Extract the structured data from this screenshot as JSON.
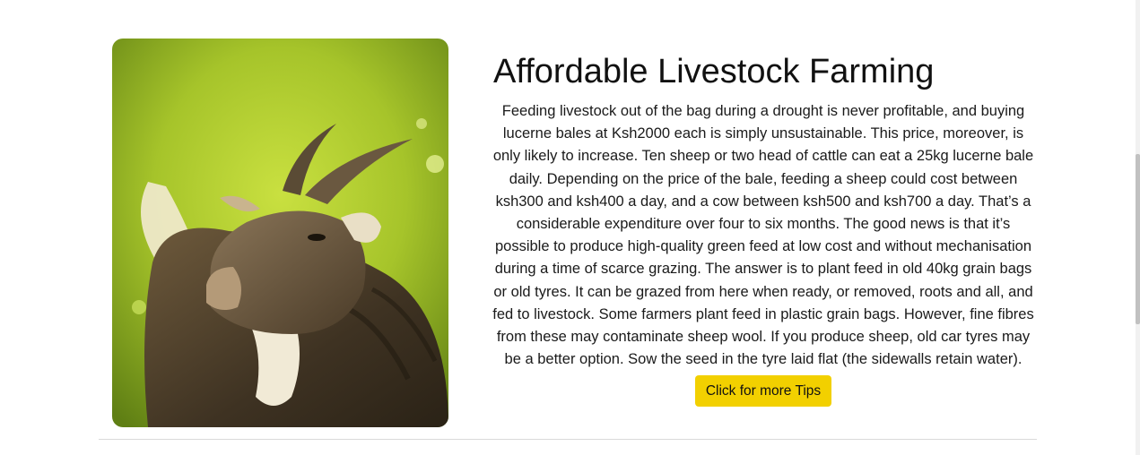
{
  "article": {
    "title": "Affordable Livestock Farming",
    "body": "Feeding livestock out of the bag during a drought is never profitable, and buying lucerne bales at Ksh2000 each is simply unsustainable. This price, moreover, is only likely to increase. Ten sheep or two head of cattle can eat a 25kg lucerne bale daily. Depending on the price of the bale, feeding a sheep could cost between ksh300 and ksh400 a day, and a cow between ksh500 and ksh700 a day. That’s a considerable expenditure over four to six months. The good news is that it’s possible to produce high-quality green feed at low cost and without mechanisation during a time of scarce grazing. The answer is to plant feed in old 40kg grain bags or old tyres. It can be grazed from here when ready, or removed, roots and all, and fed to livestock. Some farmers plant feed in plastic grain bags. However, fine fibres from these may contaminate sheep wool. If you produce sheep, old car tyres may be a better option. Sow the seed in the tyre laid flat (the sidewalls retain water).",
    "button_label": "Click for more Tips",
    "image_subject": "goat-photo"
  },
  "colors": {
    "button": "#f2d000",
    "text": "#1a1a1a",
    "divider": "#dadada"
  }
}
